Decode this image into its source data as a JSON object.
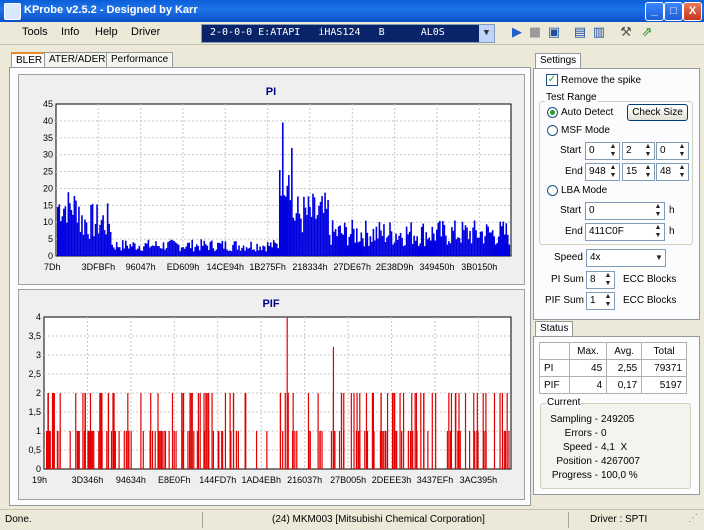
{
  "window": {
    "title": "KProbe v2.5.2 - Designed by Karr",
    "minimize": "_",
    "maximize": "□",
    "close": "X"
  },
  "menu": {
    "items": [
      "Tools",
      "Info",
      "Help",
      "Driver"
    ]
  },
  "drive": {
    "selected": "2-0-0-0 E:ATAPI   iHAS124   B      AL0S"
  },
  "toolbar": {
    "icons": [
      "play-icon",
      "stop-icon",
      "save-icon",
      "screen-icon",
      "layout-icon",
      "settings-icon",
      "exit-icon"
    ]
  },
  "tabs": [
    "BLER",
    "ATER/ADER",
    "Performance"
  ],
  "charts": [
    {
      "title": "PI",
      "y_ticks": [
        "45",
        "40",
        "35",
        "30",
        "25",
        "20",
        "15",
        "10",
        "5",
        "0"
      ],
      "x_ticks": [
        "7Dh",
        "3DFBFh",
        "96047h",
        "ED609h",
        "14CE94h",
        "1B275Fh",
        "218334h",
        "27DE67h",
        "2E38D9h",
        "349450h",
        "3B0150h"
      ]
    },
    {
      "title": "PIF",
      "y_ticks": [
        "4",
        "3,5",
        "3",
        "2,5",
        "2",
        "1,5",
        "1",
        "0,5",
        "0"
      ],
      "x_ticks": [
        "19h",
        "3D346h",
        "94634h",
        "E8E0Fh",
        "144FD7h",
        "1AD4EBh",
        "216037h",
        "27B005h",
        "2DEEE3h",
        "3437EFh",
        "3AC395h"
      ]
    }
  ],
  "settings": {
    "tab": "Settings",
    "remove_spike": "Remove the spike",
    "test_range": "Test Range",
    "auto_detect": "Auto Detect",
    "check_size": "Check Size",
    "msf_mode": "MSF Mode",
    "start_label": "Start",
    "end_label": "End",
    "msf_start": [
      "0",
      "2",
      "0"
    ],
    "msf_end": [
      "948",
      "15",
      "48"
    ],
    "lba_mode": "LBA Mode",
    "lba_start": "0",
    "lba_end": "411C0F",
    "h_unit": "h",
    "speed_label": "Speed",
    "speed_value": "4x",
    "pi_sum_label": "PI Sum",
    "pi_sum_value": "8",
    "pif_sum_label": "PIF Sum",
    "pif_sum_value": "1",
    "ecc_blocks": "ECC Blocks"
  },
  "status": {
    "tab": "Status",
    "headers": [
      "",
      "Max.",
      "Avg.",
      "Total"
    ],
    "rows": [
      [
        "PI",
        "45",
        "2,55",
        "79371"
      ],
      [
        "PIF",
        "4",
        "0,17",
        "5197"
      ]
    ],
    "current_label": "Current",
    "sampling_label": "Sampling -",
    "sampling": "249205",
    "errors_label": "Errors -",
    "errors": "0",
    "speed_label": "Speed -",
    "speed": "4,1  X",
    "position_label": "Position -",
    "position": "4267007",
    "progress_label": "Progress -",
    "progress": "100,0 %"
  },
  "statusbar": {
    "left": "Done.",
    "center": "(24) MKM003 [Mitsubishi Chemical Corporation]",
    "right": "Driver : SPTI"
  },
  "colors": {
    "pi": "#0000e0",
    "pif": "#e00000",
    "title_bar": "#0a5fd8"
  }
}
